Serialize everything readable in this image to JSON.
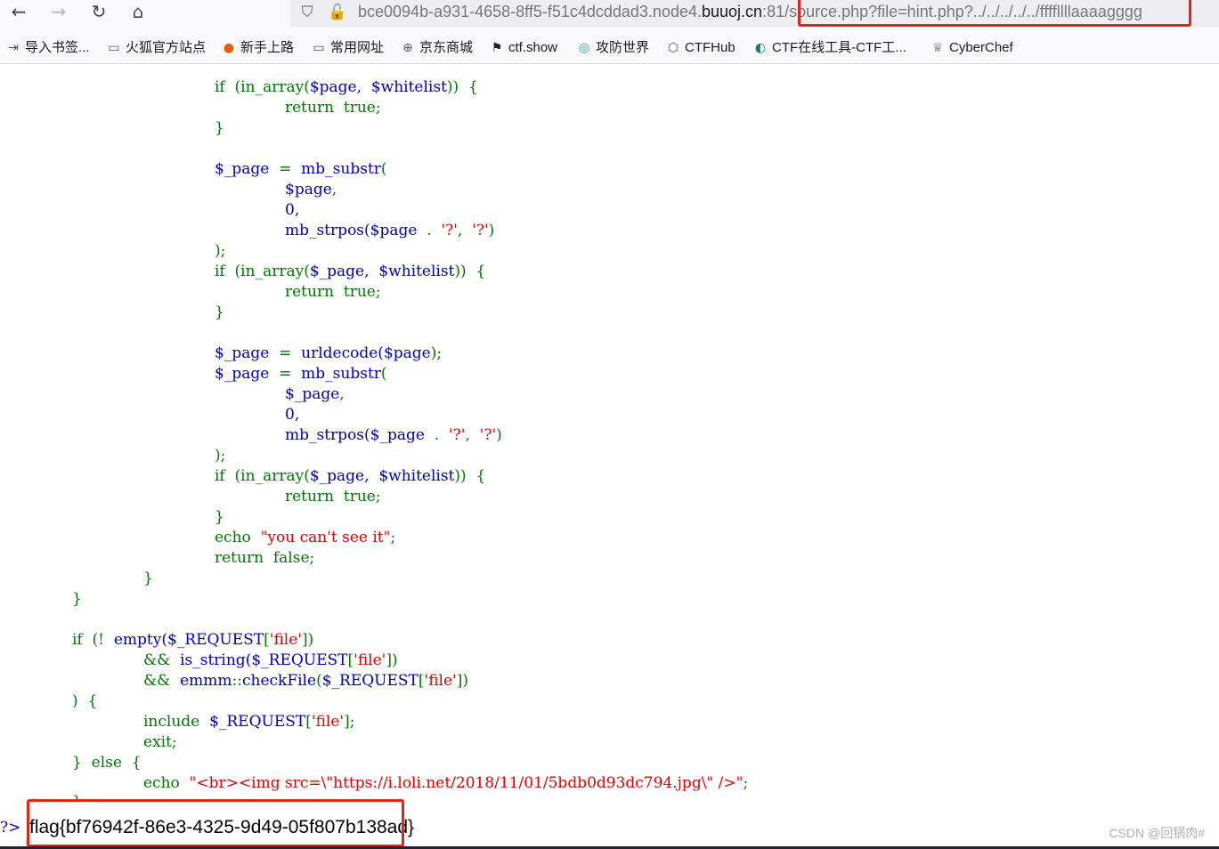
{
  "browser": {
    "url_prefix": "bce0094b-a931-4658-8ff5-f51c4dcddad3.node4.",
    "url_host": "buuoj.cn",
    "url_port": ":81",
    "url_path": "/source.php?file=hint.php?../../../../../ffffllllaaaagggg"
  },
  "bookmarks": [
    {
      "icon": "import-icon",
      "label": "导入书签..."
    },
    {
      "icon": "folder-icon",
      "label": "火狐官方站点"
    },
    {
      "icon": "firefox-icon",
      "label": "新手上路"
    },
    {
      "icon": "folder-icon",
      "label": "常用网址"
    },
    {
      "icon": "globe-icon",
      "label": "京东商城"
    },
    {
      "icon": "ctfshow-icon",
      "label": "ctf.show"
    },
    {
      "icon": "adworld-icon",
      "label": "攻防世界"
    },
    {
      "icon": "ctfhub-icon",
      "label": "CTFHub"
    },
    {
      "icon": "ctftools-icon",
      "label": "CTF在线工具-CTF工..."
    },
    {
      "icon": "cyberchef-icon",
      "label": "CyberChef"
    }
  ],
  "code": {
    "l01": [
      "if",
      "(in_array(",
      "$page,",
      "$whitelist",
      "))",
      "{"
    ],
    "l02": [
      "return",
      "true;"
    ],
    "l03": [
      "}"
    ],
    "l04": [
      "$_page",
      "=",
      "mb_substr",
      "("
    ],
    "l05": [
      "$page",
      ","
    ],
    "l06": [
      "0,"
    ],
    "l07": [
      "mb_strpos(",
      "$page",
      ".",
      "'?'",
      ",",
      "'?'",
      ")"
    ],
    "l08": [
      ");"
    ],
    "l09": [
      "if",
      "(in_array(",
      "$_page,",
      "$whitelist",
      "))",
      "{"
    ],
    "l10": [
      "return",
      "true;"
    ],
    "l11": [
      "}"
    ],
    "l12": [
      "$_page",
      "=",
      "urldecode(",
      "$page",
      ");"
    ],
    "l13": [
      "$_page",
      "=",
      "mb_substr",
      "("
    ],
    "l14": [
      "$_page",
      ","
    ],
    "l15": [
      "0,"
    ],
    "l16": [
      "mb_strpos(",
      "$_page",
      ".",
      "'?'",
      ",",
      "'?'",
      ")"
    ],
    "l17": [
      ");"
    ],
    "l18": [
      "if",
      "(in_array(",
      "$_page,",
      "$whitelist",
      "))",
      "{"
    ],
    "l19": [
      "return",
      "true;"
    ],
    "l20": [
      "}"
    ],
    "l21": [
      "echo",
      "\"you can't see it\"",
      ";"
    ],
    "l22": [
      "return",
      "false;"
    ],
    "l23": [
      "}"
    ],
    "l24": [
      "}"
    ],
    "l25": [
      "if",
      "(!",
      "empty(",
      "$_REQUEST",
      "[",
      "'file'",
      "])"
    ],
    "l26": [
      "&&",
      "is_string(",
      "$_REQUEST",
      "[",
      "'file'",
      "])"
    ],
    "l27": [
      "&&",
      "emmm",
      "::",
      "checkFile",
      "(",
      "$_REQUEST",
      "[",
      "'file'",
      "])"
    ],
    "l28": [
      ")",
      "{"
    ],
    "l29": [
      "include",
      "$_REQUEST",
      "[",
      "'file'",
      "];"
    ],
    "l30": [
      "exit;"
    ],
    "l31": [
      "}",
      "else",
      "{"
    ],
    "l32": [
      "echo",
      "\"<br><img src=\\\"https://i.loli.net/2018/11/01/5bdb0d93dc794.jpg\\\" />\"",
      ";"
    ],
    "l33": [
      "}"
    ]
  },
  "php_close": "?>",
  "flag": "flag{bf76942f-86e3-4325-9d49-05f807b138ad}",
  "watermark": "CSDN @回锅肉#"
}
